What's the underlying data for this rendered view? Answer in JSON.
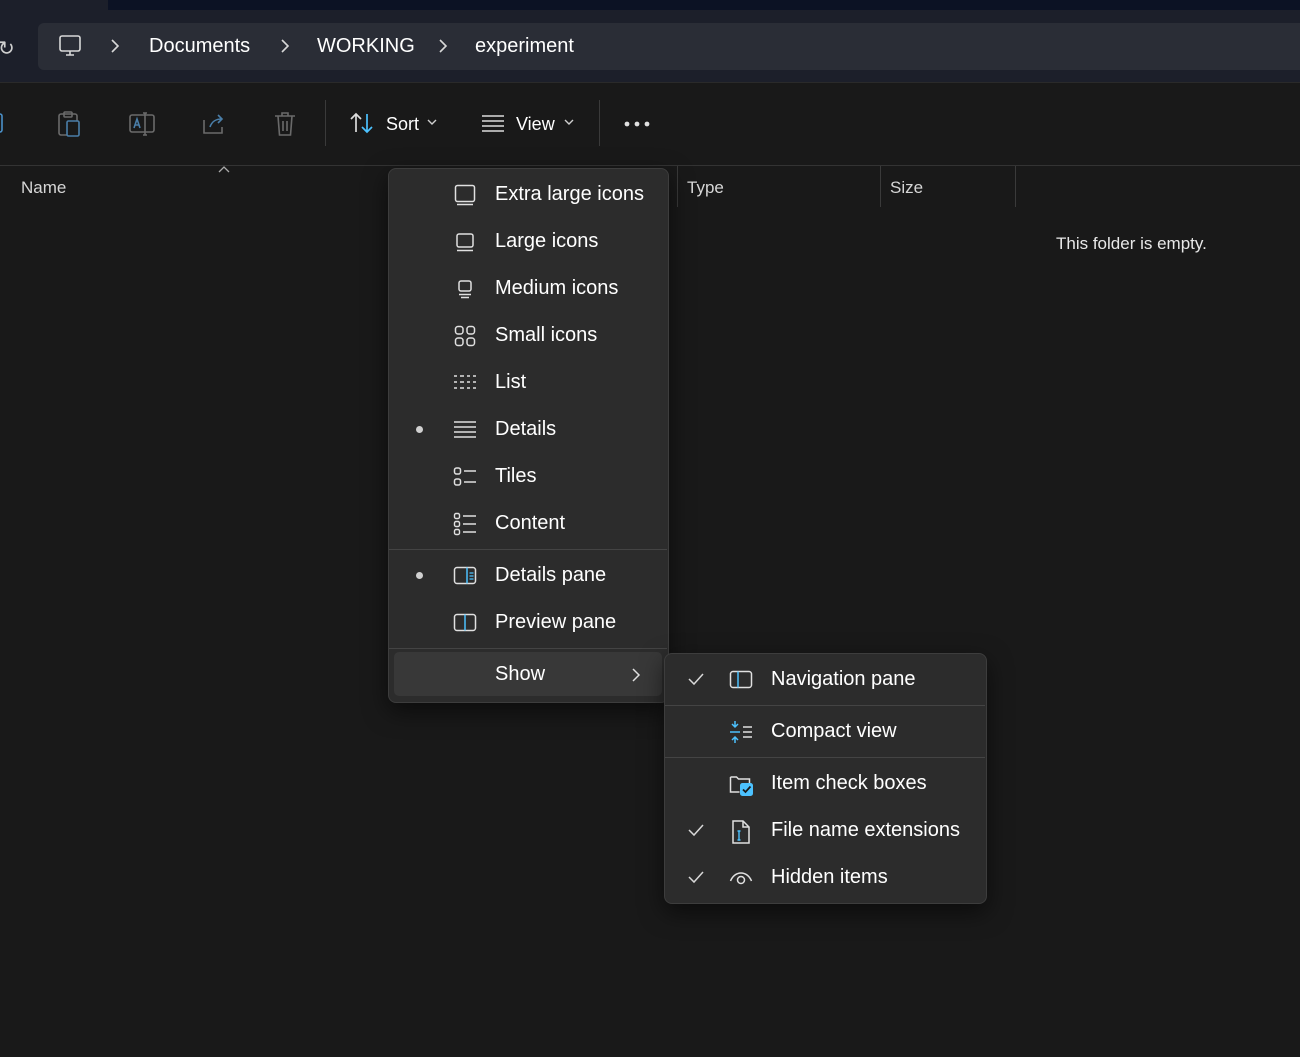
{
  "breadcrumb": {
    "items": [
      "Documents",
      "WORKING",
      "experiment"
    ]
  },
  "toolbar": {
    "sort_label": "Sort",
    "view_label": "View"
  },
  "columns": {
    "name": "Name",
    "type": "Type",
    "size": "Size"
  },
  "status": {
    "empty_message": "This folder is empty."
  },
  "view_menu": {
    "items": [
      {
        "label": "Extra large icons",
        "icon": "extra-large-icons-icon",
        "selected": false
      },
      {
        "label": "Large icons",
        "icon": "large-icons-icon",
        "selected": false
      },
      {
        "label": "Medium icons",
        "icon": "medium-icons-icon",
        "selected": false
      },
      {
        "label": "Small icons",
        "icon": "small-icons-icon",
        "selected": false
      },
      {
        "label": "List",
        "icon": "list-icon",
        "selected": false
      },
      {
        "label": "Details",
        "icon": "details-icon",
        "selected": true
      },
      {
        "label": "Tiles",
        "icon": "tiles-icon",
        "selected": false
      },
      {
        "label": "Content",
        "icon": "content-icon",
        "selected": false
      }
    ],
    "panes": [
      {
        "label": "Details pane",
        "icon": "details-pane-icon",
        "selected": true
      },
      {
        "label": "Preview pane",
        "icon": "preview-pane-icon",
        "selected": false
      }
    ],
    "show_label": "Show"
  },
  "show_menu": {
    "items": [
      {
        "label": "Navigation pane",
        "icon": "navigation-pane-icon",
        "checked": true
      },
      {
        "label": "Compact view",
        "icon": "compact-view-icon",
        "checked": false
      },
      {
        "label": "Item check boxes",
        "icon": "item-check-boxes-icon",
        "checked": false
      },
      {
        "label": "File name extensions",
        "icon": "file-name-extensions-icon",
        "checked": true
      },
      {
        "label": "Hidden items",
        "icon": "hidden-items-icon",
        "checked": true
      }
    ]
  },
  "colors": {
    "background": "#191919",
    "menu_background": "#2c2c2c",
    "accent": "#4cc2ff"
  }
}
